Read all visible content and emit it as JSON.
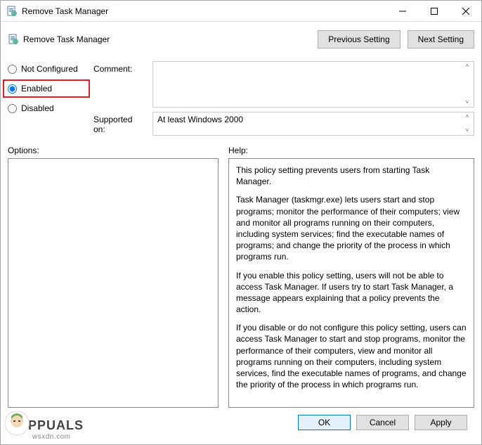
{
  "titlebar": {
    "title": "Remove Task Manager"
  },
  "header": {
    "subtitle": "Remove Task Manager",
    "previous_btn": "Previous Setting",
    "next_btn": "Next Setting"
  },
  "config": {
    "not_configured": "Not Configured",
    "enabled": "Enabled",
    "disabled": "Disabled"
  },
  "fields": {
    "comment_label": "Comment:",
    "comment_value": "",
    "supported_label": "Supported on:",
    "supported_value": "At least Windows 2000"
  },
  "sections": {
    "options_label": "Options:",
    "help_label": "Help:"
  },
  "help": {
    "p1": "This policy setting prevents users from starting Task Manager.",
    "p2": "Task Manager (taskmgr.exe) lets users start and stop programs; monitor the performance of their computers; view and monitor all programs running on their computers, including system services; find the executable names of programs; and change the priority of the process in which programs run.",
    "p3": "If you enable this policy setting, users will not be able to access Task Manager. If users try to start Task Manager, a message appears explaining that a policy prevents the action.",
    "p4": "If you disable or do not configure this policy setting, users can access Task Manager to  start and stop programs, monitor the performance of their computers, view and monitor all programs running on their computers, including system services, find the executable names of programs, and change the priority of the process in which programs run."
  },
  "buttons": {
    "ok": "OK",
    "cancel": "Cancel",
    "apply": "Apply"
  },
  "watermark": {
    "brand": "PPUALS",
    "url": "wsxdn.com"
  }
}
